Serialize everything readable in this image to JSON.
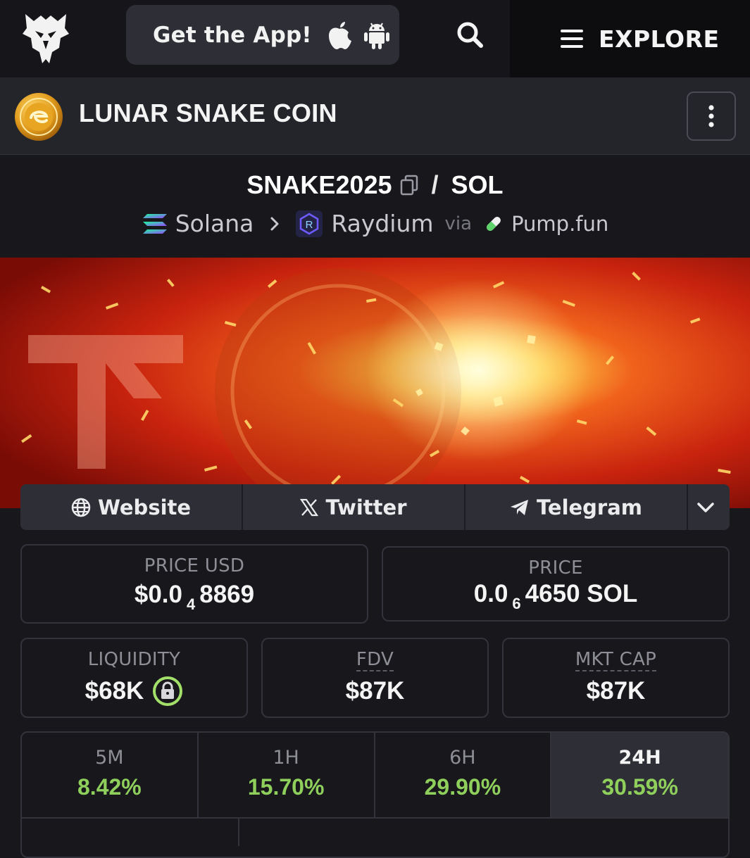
{
  "topbar": {
    "app_button_label": "Get the App!",
    "explore_label": "EXPLORE"
  },
  "token": {
    "name": "LUNAR SNAKE COIN"
  },
  "pair": {
    "base": "SNAKE2025",
    "quote": "SOL",
    "chain": "Solana",
    "dex": "Raydium",
    "via_label": "via",
    "launchpad": "Pump.fun"
  },
  "links": {
    "website": "Website",
    "twitter": "Twitter",
    "telegram": "Telegram"
  },
  "stats": {
    "price_usd": {
      "label": "PRICE USD",
      "prefix": "$0.0",
      "zeros": "4",
      "digits": "8869"
    },
    "price_native": {
      "label": "PRICE",
      "prefix": "0.0",
      "zeros": "6",
      "digits": "4650 SOL"
    },
    "liquidity": {
      "label": "LIQUIDITY",
      "value": "$68K"
    },
    "fdv": {
      "label": "FDV",
      "value": "$87K"
    },
    "mkt_cap": {
      "label": "MKT CAP",
      "value": "$87K"
    }
  },
  "changes": [
    {
      "period": "5M",
      "value": "8.42%"
    },
    {
      "period": "1H",
      "value": "15.70%"
    },
    {
      "period": "6H",
      "value": "29.90%"
    },
    {
      "period": "24H",
      "value": "30.59%",
      "active": true
    }
  ],
  "colors": {
    "positive": "#8fcf5b",
    "lock_ring": "#a3e06a",
    "background": "#17171c"
  }
}
